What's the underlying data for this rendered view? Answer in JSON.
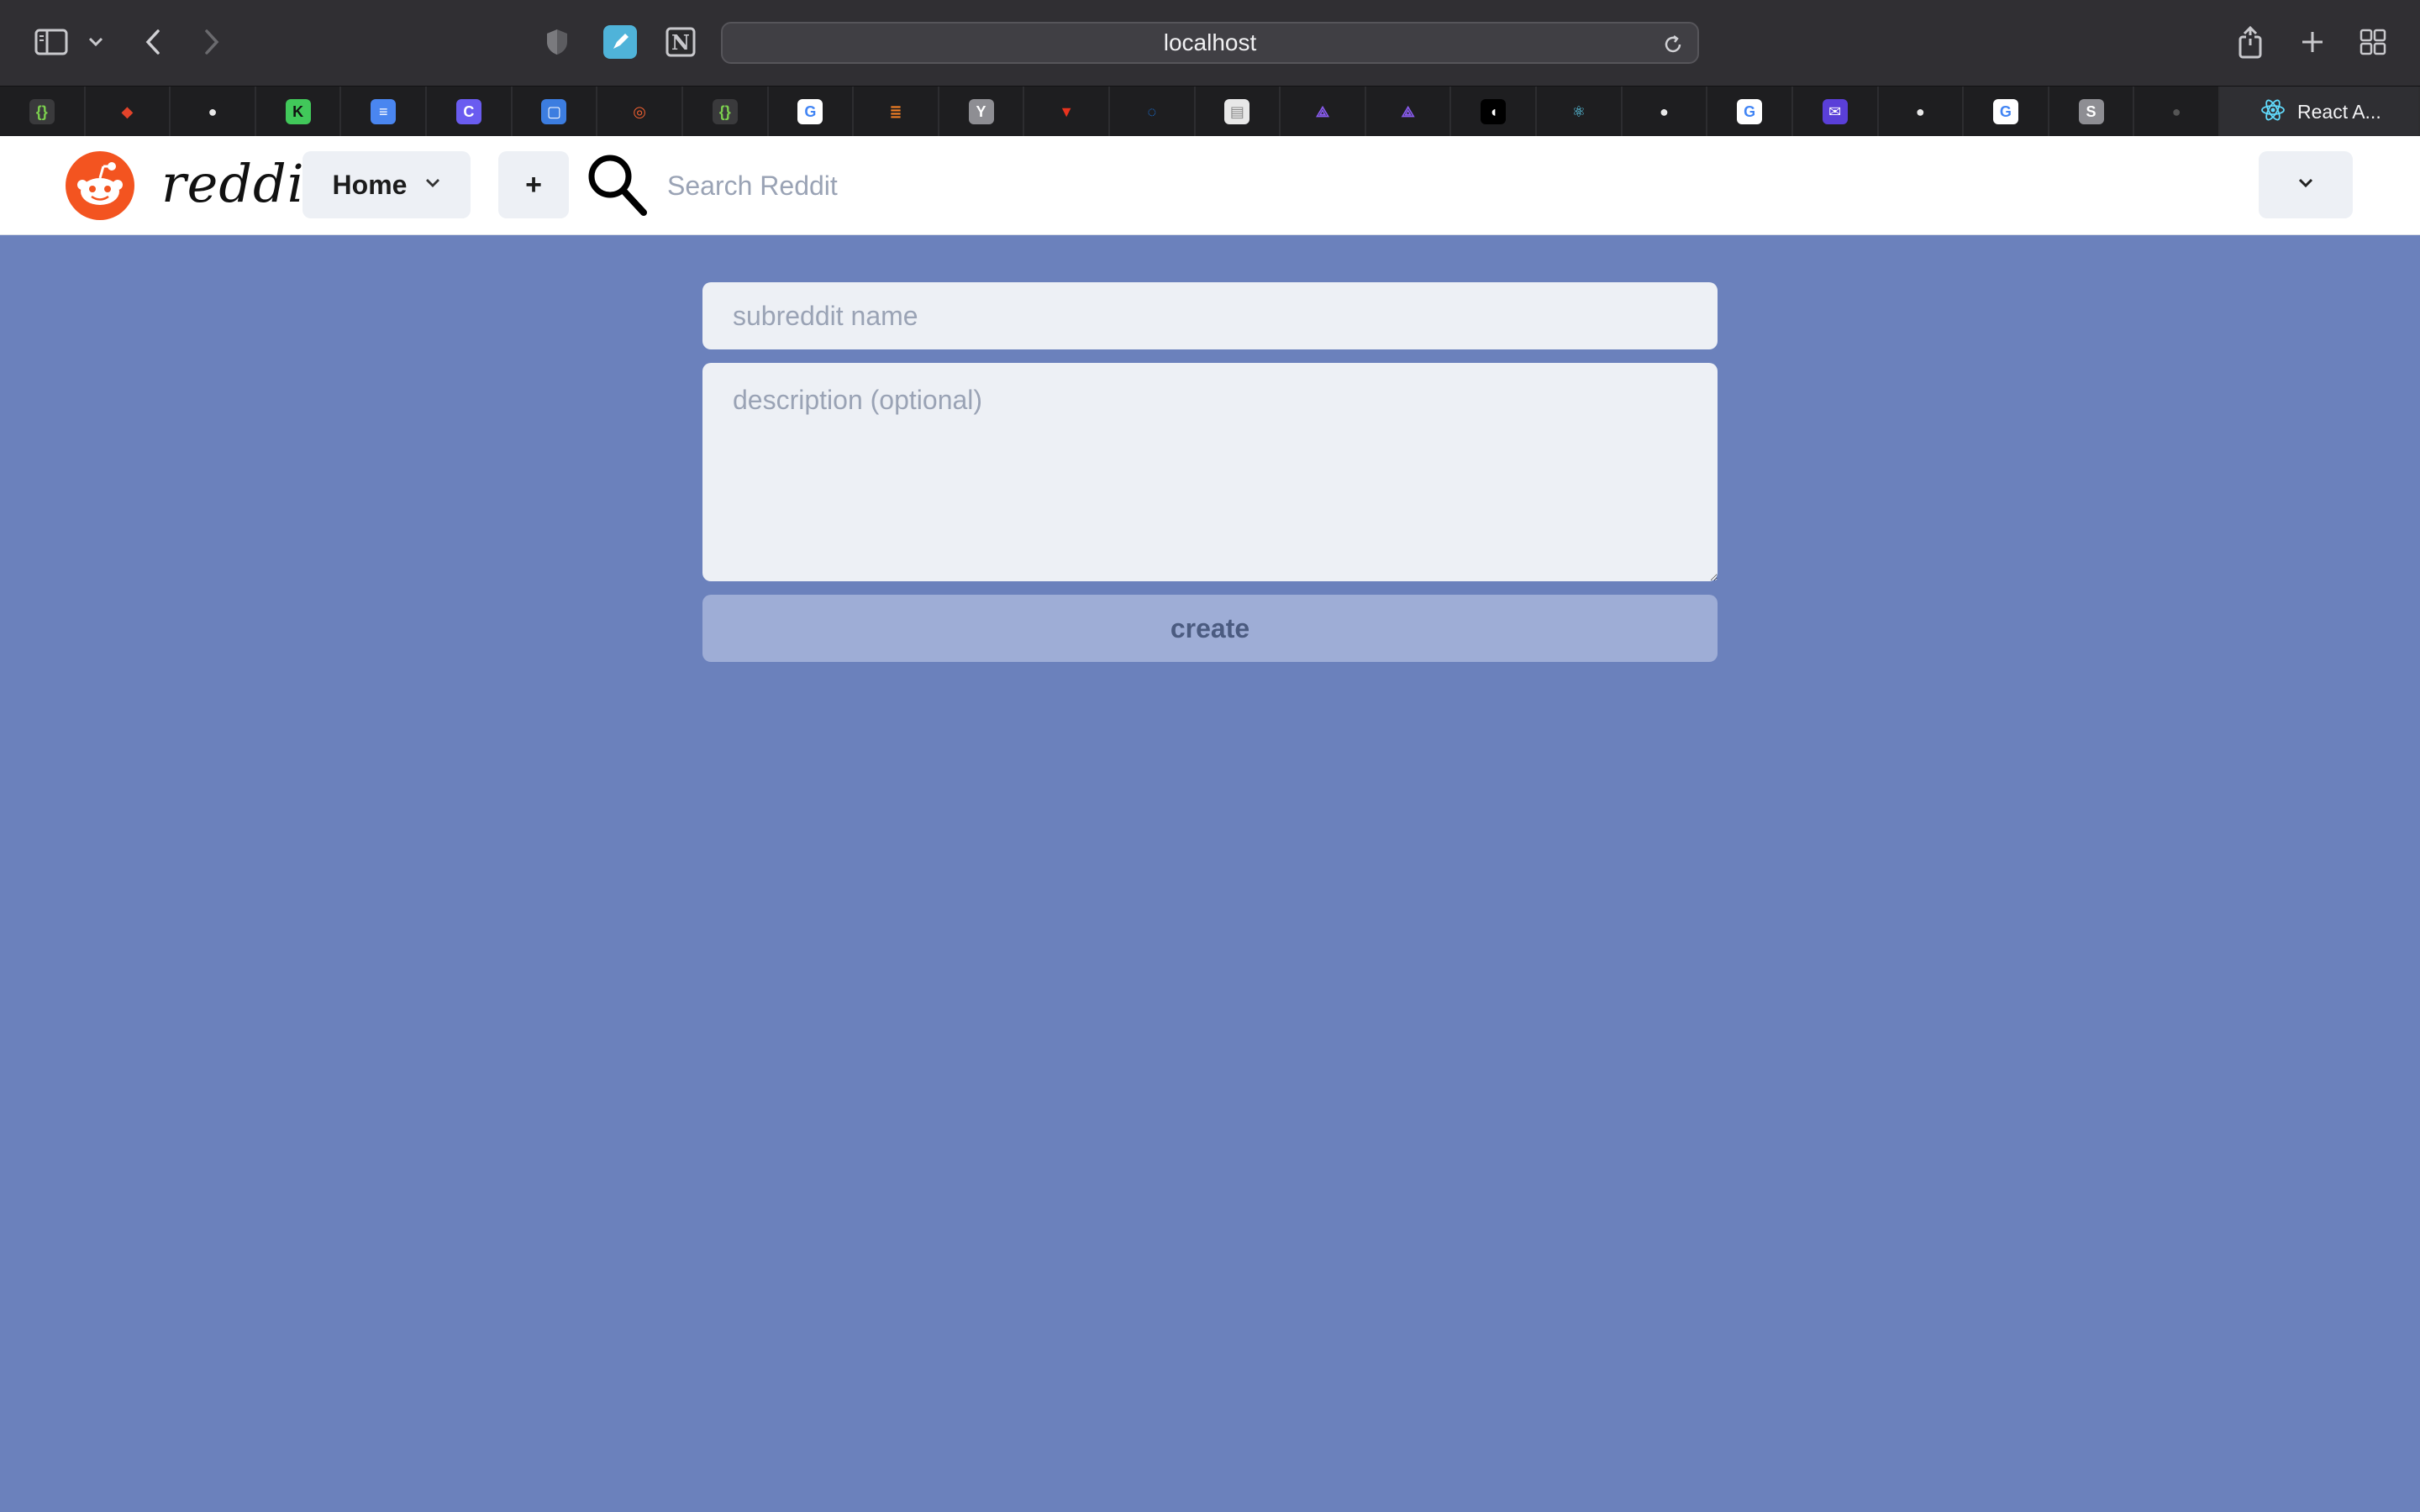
{
  "browser": {
    "address": "localhost",
    "tabs": [
      {
        "icon": "curly-braces-icon",
        "bg": "#3a3a3c",
        "fg": "#7cd14e",
        "glyph": "{}"
      },
      {
        "icon": "gitlab-icon",
        "bg": "#1e1e20",
        "fg": "#e2432a",
        "glyph": "◆"
      },
      {
        "icon": "github-icon",
        "bg": "#1e1e20",
        "fg": "#e8e8e8",
        "glyph": "●"
      },
      {
        "icon": "dk-icon",
        "bg": "#41c85a",
        "fg": "#111",
        "glyph": "K"
      },
      {
        "icon": "docs-icon",
        "bg": "#4a86f0",
        "fg": "#fff",
        "glyph": "≡"
      },
      {
        "icon": "c-icon",
        "bg": "#6a5cf0",
        "fg": "#fff",
        "glyph": "C"
      },
      {
        "icon": "frame-icon",
        "bg": "#3c7de0",
        "fg": "#fff",
        "glyph": "▢"
      },
      {
        "icon": "ring-icon",
        "bg": "#1e1e20",
        "fg": "#f06030",
        "glyph": "◎"
      },
      {
        "icon": "curly-braces-icon",
        "bg": "#3a3a3c",
        "fg": "#7cd14e",
        "glyph": "{}"
      },
      {
        "icon": "google-icon",
        "bg": "#ffffff",
        "fg": "#4285f4",
        "glyph": "G"
      },
      {
        "icon": "stackoverflow-icon",
        "bg": "#1e1e20",
        "fg": "#f48024",
        "glyph": "≣"
      },
      {
        "icon": "y-icon",
        "bg": "#8e8e93",
        "fg": "#fff",
        "glyph": "Y"
      },
      {
        "icon": "triangle-icon",
        "bg": "#1e1e20",
        "fg": "#e8331e",
        "glyph": "▼"
      },
      {
        "icon": "digitalocean-icon",
        "bg": "#1e1e20",
        "fg": "#1a7cf0",
        "glyph": "◌"
      },
      {
        "icon": "page-icon",
        "bg": "#e8e8e8",
        "fg": "#888",
        "glyph": "▤"
      },
      {
        "icon": "graphql-icon",
        "bg": "#1e1e20",
        "fg": "#8a5cf0",
        "glyph": "⟁"
      },
      {
        "icon": "graphql-icon",
        "bg": "#1e1e20",
        "fg": "#8a5cf0",
        "glyph": "⟁"
      },
      {
        "icon": "bird-icon",
        "bg": "#000000",
        "fg": "#fff",
        "glyph": "◖"
      },
      {
        "icon": "react-icon",
        "bg": "#1e1e20",
        "fg": "#61dafb",
        "glyph": "⚛"
      },
      {
        "icon": "github-icon",
        "bg": "#1e1e20",
        "fg": "#e8e8e8",
        "glyph": "●"
      },
      {
        "icon": "google-icon",
        "bg": "#ffffff",
        "fg": "#4285f4",
        "glyph": "G"
      },
      {
        "icon": "mail-icon",
        "bg": "#5a3fd8",
        "fg": "#fff",
        "glyph": "✉"
      },
      {
        "icon": "github-icon",
        "bg": "#1e1e20",
        "fg": "#e8e8e8",
        "glyph": "●"
      },
      {
        "icon": "google-icon",
        "bg": "#ffffff",
        "fg": "#4285f4",
        "glyph": "G"
      },
      {
        "icon": "s-icon",
        "bg": "#8e8e93",
        "fg": "#fff",
        "glyph": "S"
      },
      {
        "icon": "github-icon",
        "bg": "#1e1e20",
        "fg": "#555",
        "glyph": "●"
      }
    ],
    "active_tab": {
      "icon": "react-icon",
      "title": "React A..."
    }
  },
  "header": {
    "wordmark": "reddit",
    "home_label": "Home",
    "plus_label": "+",
    "search_placeholder": "Search Reddit"
  },
  "form": {
    "name_placeholder": "subreddit name",
    "description_placeholder": "description (optional)",
    "create_label": "create"
  },
  "colors": {
    "page_bg": "#6b81bc",
    "reddit_orange": "#f35420",
    "button_bg": "#edf0f5",
    "create_bg": "#9eadd6"
  }
}
